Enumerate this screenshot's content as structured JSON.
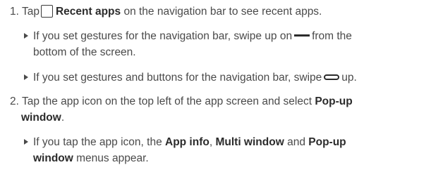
{
  "step1": {
    "number": "1.",
    "text_before_icon": "Tap",
    "bold_label": "Recent apps",
    "text_after": "on the navigation bar to see recent apps."
  },
  "bullet1": {
    "line1_before_icon": "If you set gestures for the navigation bar, swipe up on",
    "line1_after_icon": "from the",
    "line2": "bottom of the screen."
  },
  "bullet2": {
    "before_icon": "If you set gestures and buttons for the navigation bar, swipe",
    "after_icon": "up."
  },
  "step2": {
    "number": "2.",
    "line1_text": "Tap the app icon on the top left of the app screen and select",
    "line1_bold": "Pop-up",
    "line2_bold": "window",
    "line2_after": "."
  },
  "bullet3": {
    "line1_before": "If you tap the app icon, the",
    "bold_app_info": "App info",
    "comma": ",",
    "bold_multi_window": "Multi window",
    "and_text": "and",
    "bold_popup": "Pop-up",
    "line2_bold": "window",
    "line2_after": "menus appear."
  },
  "icons": {
    "recent_apps": "recent-apps-square-icon",
    "gesture_line": "gesture-bar-line-icon",
    "gesture_pill": "gesture-pill-icon"
  }
}
